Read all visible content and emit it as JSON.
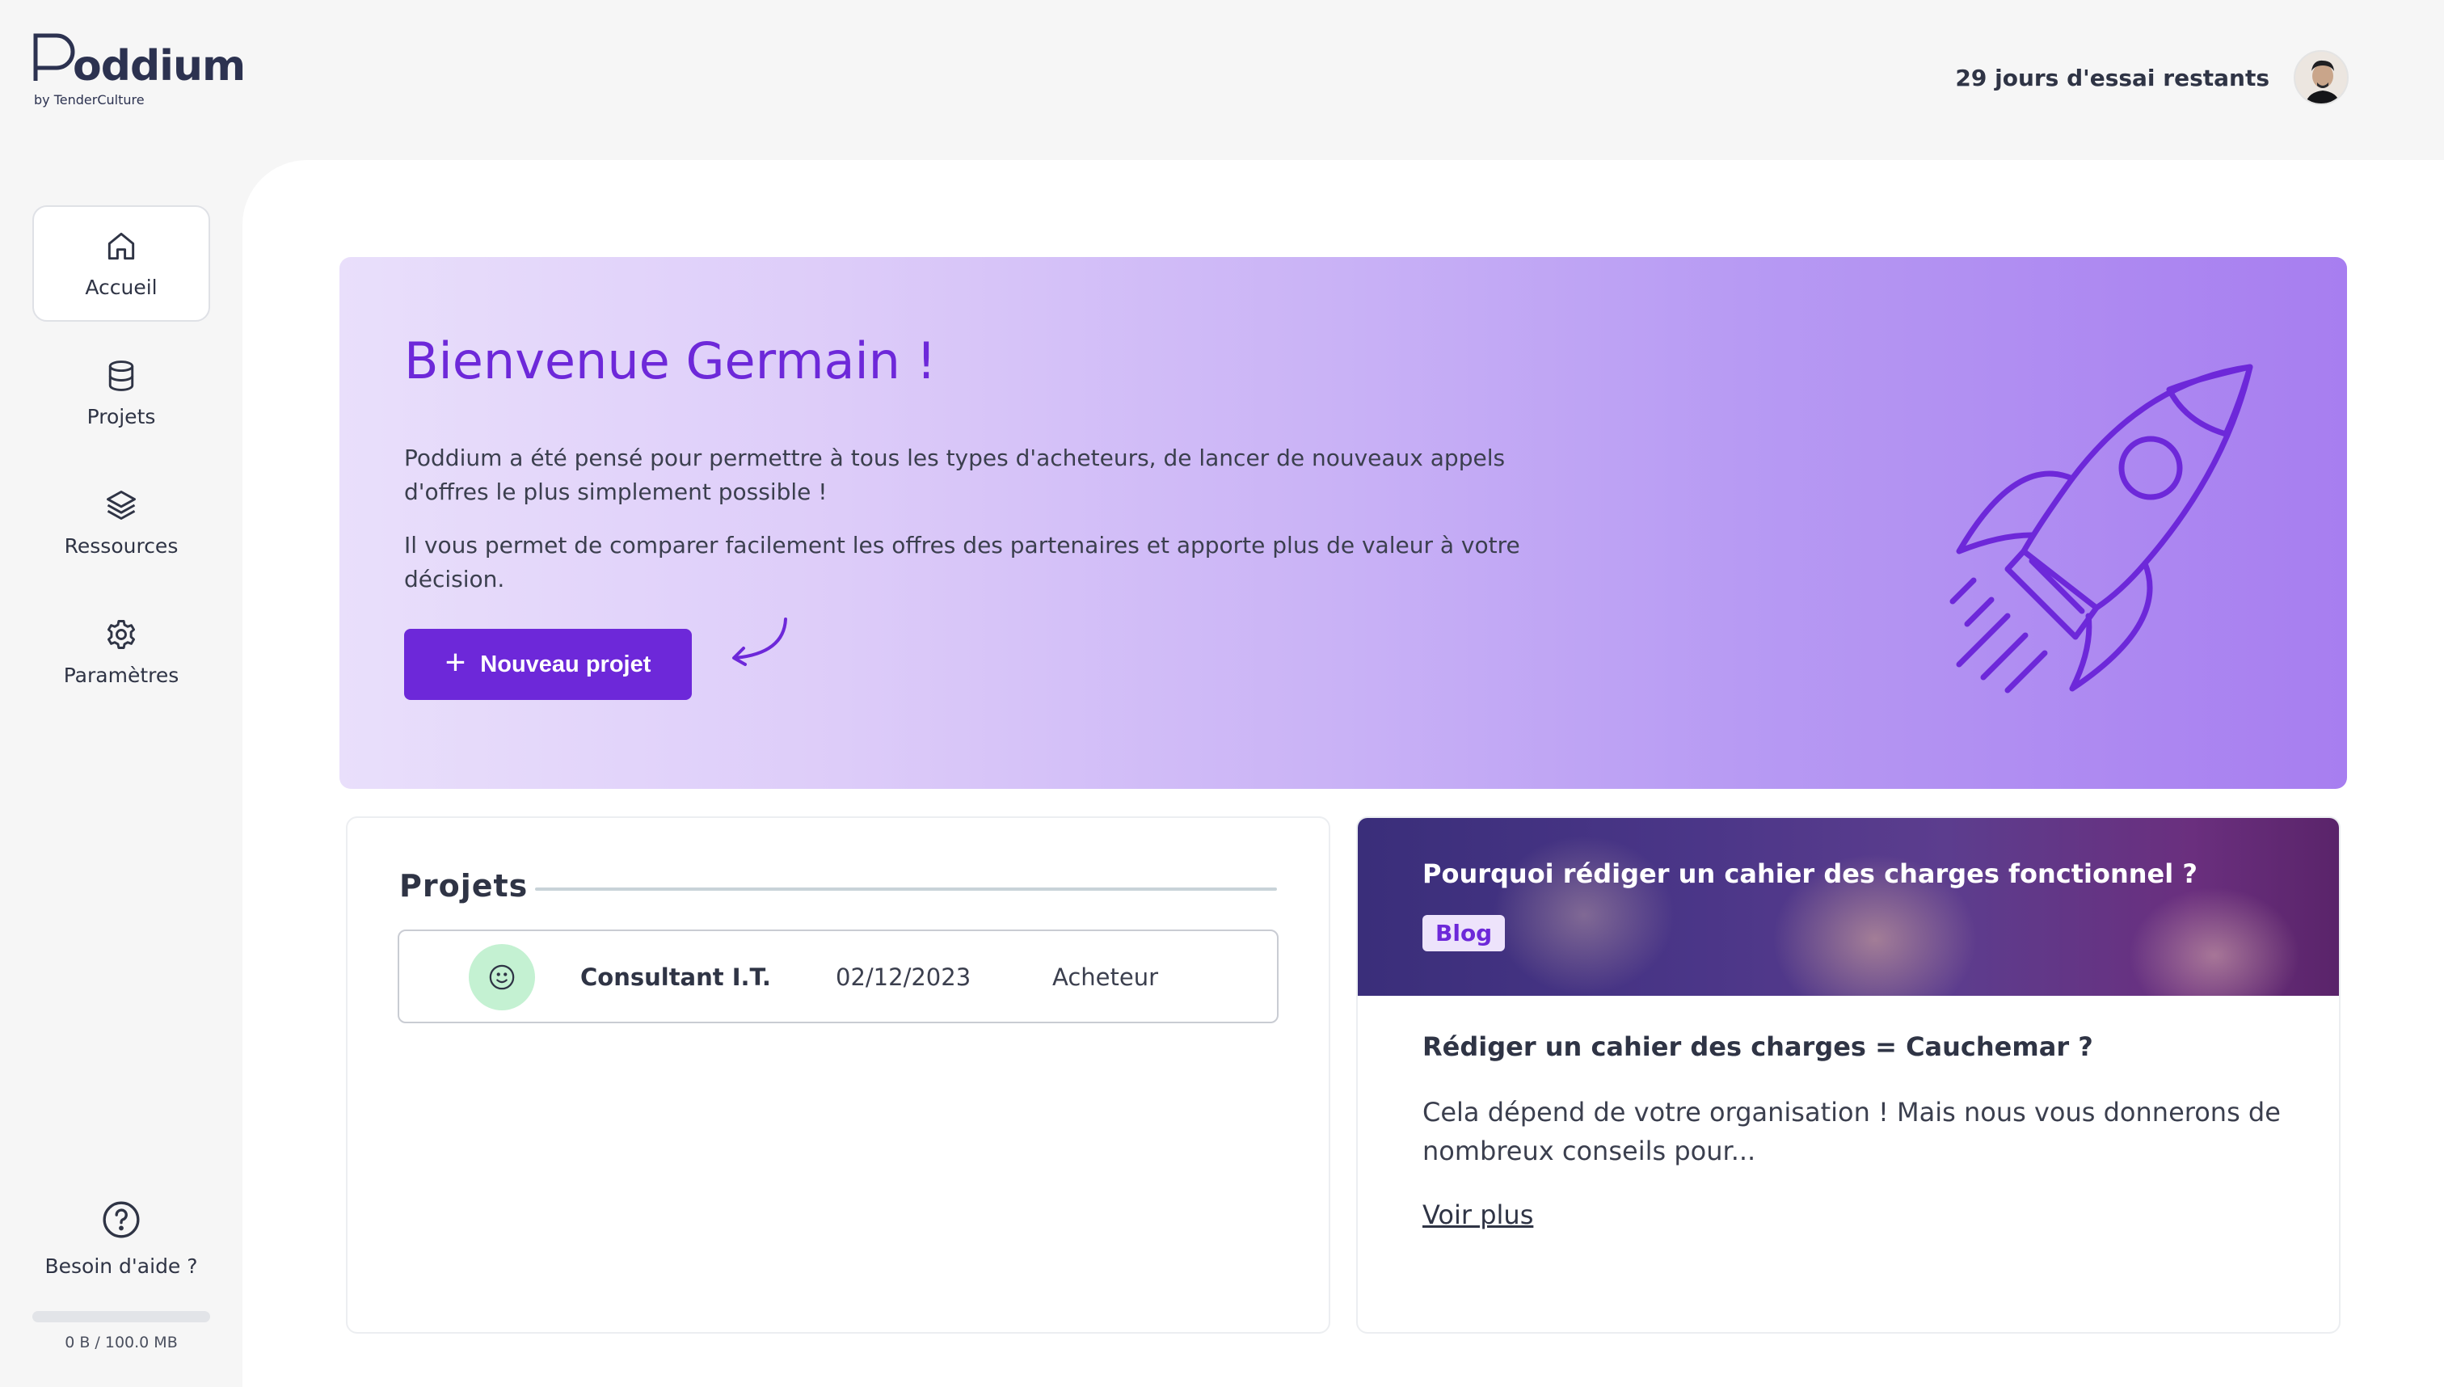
{
  "brand": {
    "name_rest": "oddium",
    "tagline": "by TenderCulture"
  },
  "header": {
    "trial_text": "29 jours d'essai restants"
  },
  "sidebar": {
    "items": [
      {
        "label": "Accueil",
        "icon": "home-icon",
        "active": true
      },
      {
        "label": "Projets",
        "icon": "database-icon",
        "active": false
      },
      {
        "label": "Ressources",
        "icon": "layers-icon",
        "active": false
      },
      {
        "label": "Paramètres",
        "icon": "gear-icon",
        "active": false
      }
    ],
    "help_label": "Besoin d'aide ?",
    "storage": {
      "text": "0 B / 100.0 MB",
      "used_fraction": 0
    }
  },
  "hero": {
    "title": "Bienvenue Germain !",
    "paragraph_1": "Poddium a été pensé pour permettre à tous les types d'acheteurs, de lancer de nouveaux appels d'offres le plus simplement possible !",
    "paragraph_2": "Il vous permet de comparer facilement les offres des partenaires et apporte plus de valeur à votre décision.",
    "button_label": "Nouveau projet"
  },
  "projects": {
    "title": "Projets",
    "rows": [
      {
        "name": "Consultant I.T.",
        "date": "02/12/2023",
        "role": "Acheteur"
      }
    ]
  },
  "blog": {
    "image_title": "Pourquoi rédiger un cahier des charges fonctionnel ?",
    "badge": "Blog",
    "heading": "Rédiger un cahier des charges = Cauchemar ?",
    "excerpt": "Cela dépend de votre organisation ! Mais nous vous donnerons de nombreux conseils pour...",
    "more_label": "Voir plus"
  },
  "colors": {
    "accent": "#6d28d9",
    "text": "#2f3445",
    "success_bg": "#c4f1d2"
  }
}
